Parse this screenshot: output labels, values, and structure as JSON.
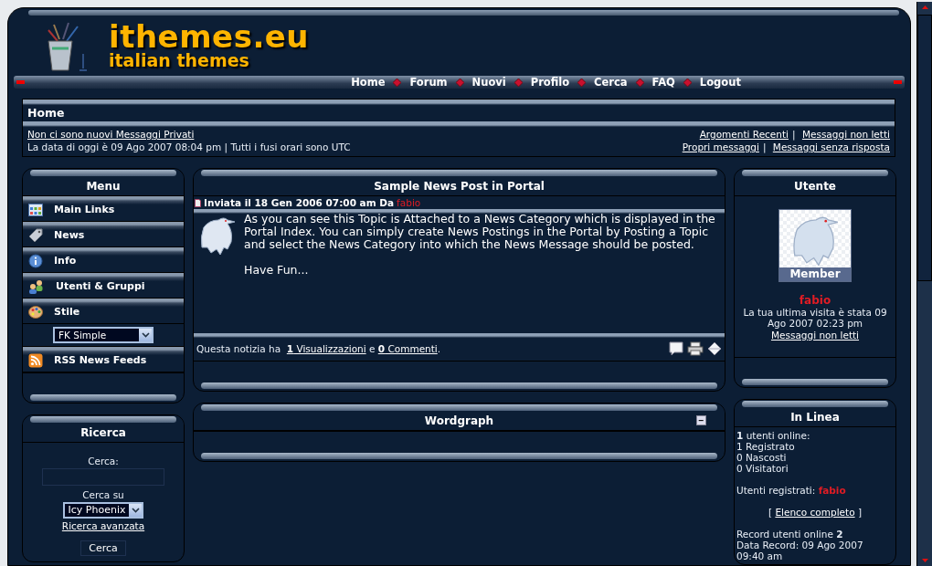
{
  "header": {
    "logo_title": "ithemes.eu",
    "logo_subtitle": "italian themes"
  },
  "nav": [
    "Home",
    "Forum",
    "Nuovi",
    "Profilo",
    "Cerca",
    "FAQ",
    "Logout"
  ],
  "breadcrumb": {
    "title": "Home",
    "private_messages": "Non ci sono nuovi Messaggi Privati",
    "date_line": "La data di oggi è 09 Ago 2007 08:04 pm | Tutti i fusi orari sono UTC",
    "links_row_1": [
      "Argomenti Recenti",
      "Messaggi non letti"
    ],
    "links_row_2": [
      "Propri messaggi",
      "Messaggi senza risposta"
    ],
    "separator": "|"
  },
  "menu": {
    "title": "Menu",
    "items": [
      {
        "kind": "link",
        "label": "Main Links"
      },
      {
        "kind": "link",
        "label": "News"
      },
      {
        "kind": "link",
        "label": "Info"
      },
      {
        "kind": "link",
        "label": "Utenti & Gruppi"
      },
      {
        "kind": "link",
        "label": "Stile"
      },
      {
        "kind": "select",
        "value": "FK Simple"
      },
      {
        "kind": "link",
        "label": "RSS News Feeds"
      }
    ]
  },
  "search": {
    "title": "Ricerca",
    "label": "Cerca:",
    "scope_label": "Cerca su",
    "scope_value": "Icy Phoenix",
    "advanced_link": "Ricerca avanzata",
    "button": "Cerca"
  },
  "news": {
    "title": "Sample News Post in Portal",
    "meta": "Inviata il  18 Gen 2006 07:00 am Da",
    "author": "fabio",
    "paragraphs": [
      "As you can see this Topic is Attached to a News Category which is displayed in the Portal Index. You can simply create News Postings in the Portal by Posting a Topic and select the News Category into which the News Message should be posted.",
      "Have Fun..."
    ],
    "footer_prefix": "Questa notizia ha",
    "views_link": "**1** Visualizzazioni",
    "conjunction": "e",
    "comments_link": "**0** Commenti",
    "footer_suffix": "."
  },
  "wordgraph": {
    "title": "Wordgraph",
    "collapse_symbol": "−"
  },
  "user": {
    "title": "Utente",
    "rank": "Member",
    "username": "fabio",
    "last_visit": "La tua ultima visita è stata 09 Ago 2007 02:23 pm",
    "link": "Messaggi non letti"
  },
  "online": {
    "title": "In Linea",
    "stats": [
      "**1** utenti online:",
      "1 Registrato",
      "0 Nascosti",
      "0 Visitatori"
    ],
    "registered_label": "Utenti registrati:",
    "registered_user": "fabio",
    "list_open": "[",
    "list_link": "Elenco completo",
    "list_close": "]",
    "record": "Record utenti online **2**",
    "record_date": "Data Record: 09 Ago 2007 09:40 am"
  }
}
